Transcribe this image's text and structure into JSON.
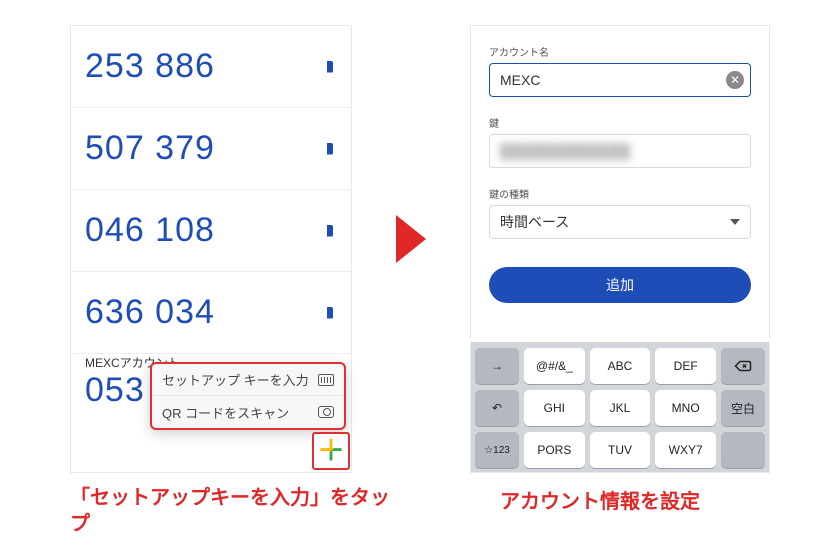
{
  "left": {
    "codes": [
      "253 886",
      "507 379",
      "046 108",
      "636 034"
    ],
    "account_label": "MEXCアカウント",
    "partial_code": "053",
    "menu": {
      "enter_key": "セットアップ キーを入力",
      "scan_qr": "QR コードをスキャン"
    }
  },
  "right": {
    "account_name_label": "アカウント名",
    "account_name_value": "MEXC",
    "key_label": "鍵",
    "key_value_masked": "████████████",
    "key_type_label": "鍵の種類",
    "key_type_value": "時間ベース",
    "add_button": "追加"
  },
  "keyboard": {
    "r1": [
      "@#/&_",
      "ABC",
      "DEF"
    ],
    "r2": [
      "GHI",
      "JKL",
      "MNO"
    ],
    "r3": [
      "PORS",
      "TUV",
      "WXY7"
    ],
    "space_label": "空白",
    "globe": "→",
    "undo": "↶",
    "numlock": "☆123"
  },
  "captions": {
    "left": "「セットアップキーを入力」をタップ",
    "right": "アカウント情報を設定"
  }
}
